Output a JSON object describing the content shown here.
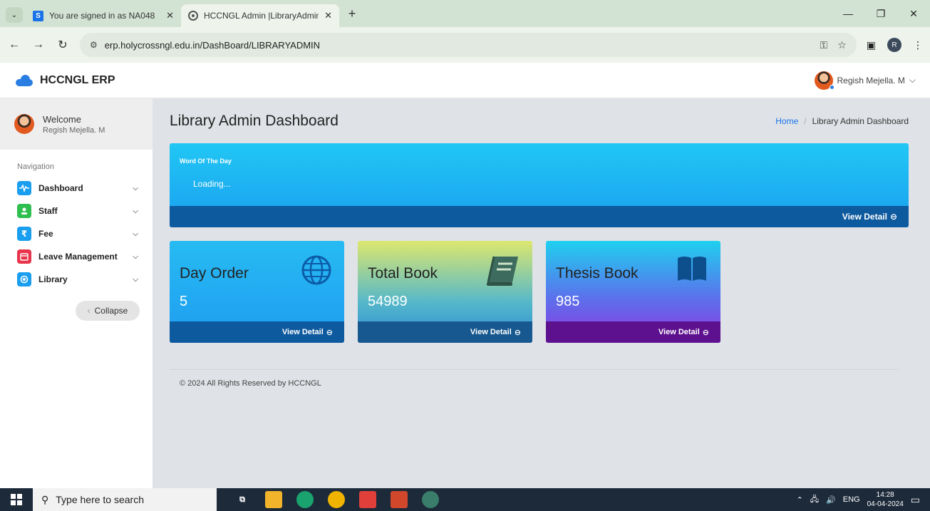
{
  "browser": {
    "tabs": [
      {
        "title": "You are signed in as NA048",
        "favicon": "S"
      },
      {
        "title": "HCCNGL Admin |LibraryAdmin",
        "favicon": "globe"
      }
    ],
    "new_tab": "+",
    "url": "erp.holycrossngl.edu.in/DashBoard/LIBRARYADMIN",
    "profile_initial": "R"
  },
  "app": {
    "brand": "HCCNGL ERP",
    "user_name": "Regish Mejella. M",
    "brand_color": "#2a7de1"
  },
  "sidebar": {
    "welcome": "Welcome",
    "welcome_name": "Regish Mejella. M",
    "nav_label": "Navigation",
    "items": [
      {
        "label": "Dashboard",
        "icon": "pulse-icon",
        "color": "#1a9ef0"
      },
      {
        "label": "Staff",
        "icon": "staff-icon",
        "color": "#2fbf4f"
      },
      {
        "label": "Fee",
        "icon": "rupee-icon",
        "color": "#1a9ef0"
      },
      {
        "label": "Leave Management",
        "icon": "calendar-icon",
        "color": "#e8344a"
      },
      {
        "label": "Library",
        "icon": "library-icon",
        "color": "#1a9ef0"
      }
    ],
    "collapse_label": "Collapse"
  },
  "main": {
    "title": "Library Admin Dashboard",
    "breadcrumb": {
      "home": "Home",
      "sep": "/",
      "current": "Library Admin Dashboard"
    },
    "word_card": {
      "title": "Word Of The Day",
      "text": "Loading...",
      "footer": "View Detail"
    },
    "cards": [
      {
        "label": "Day Order",
        "value": "5",
        "footer": "View Detail",
        "icon": "globe-icon"
      },
      {
        "label": "Total Book",
        "value": "54989",
        "footer": "View Detail",
        "icon": "book-icon"
      },
      {
        "label": "Thesis Book",
        "value": "985",
        "footer": "View Detail",
        "icon": "open-book-icon"
      }
    ],
    "footer": "© 2024 All Rights Reserved by HCCNGL"
  },
  "taskbar": {
    "search_placeholder": "Type here to search",
    "lang": "ENG",
    "time": "14:28",
    "date": "04-04-2024"
  }
}
